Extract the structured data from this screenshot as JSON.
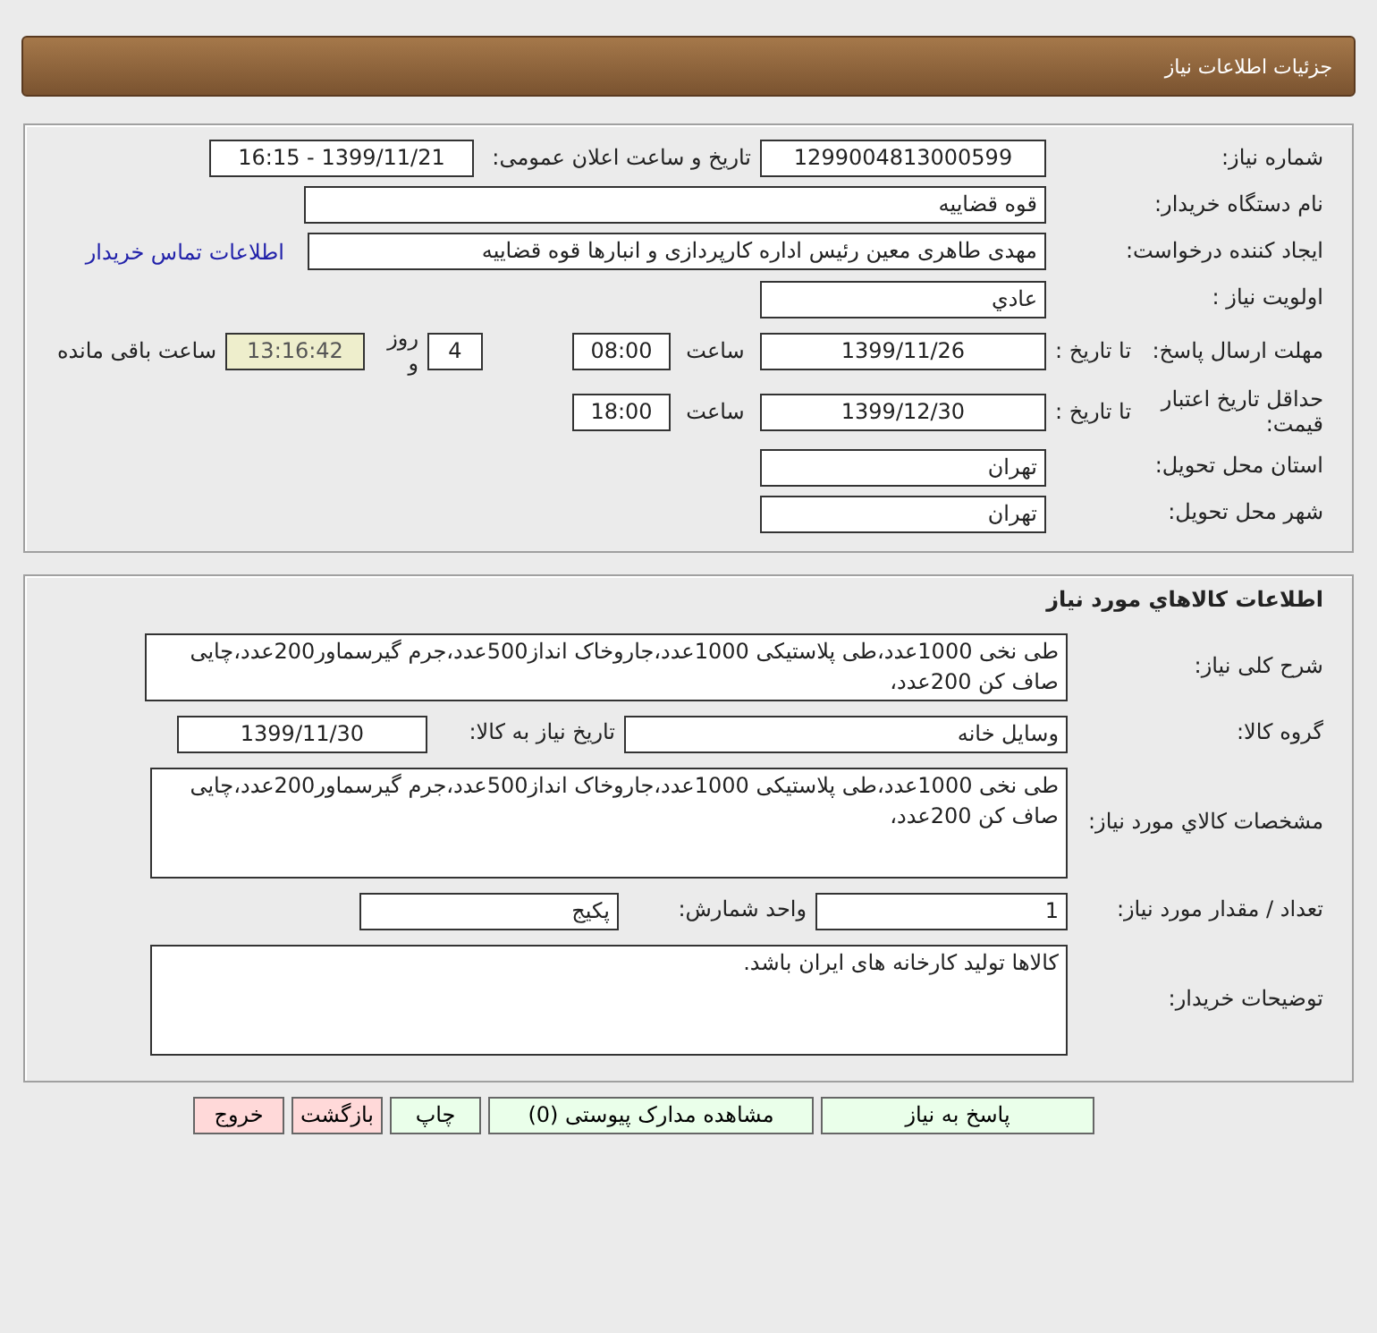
{
  "header": {
    "title": "جزئیات اطلاعات نیاز"
  },
  "need": {
    "number_label": "شماره نیاز:",
    "number": "1299004813000599",
    "announce_label": "تاریخ و ساعت اعلان عمومی:",
    "announce": "1399/11/21 - 16:15",
    "buyer_label": "نام دستگاه خریدار:",
    "buyer": "قوه قضاییه",
    "creator_label": "ایجاد کننده درخواست:",
    "creator": "مهدی طاهری معین رئیس اداره کارپردازی و انبارها قوه قضاییه",
    "contact_link": "اطلاعات تماس خریدار",
    "priority_label": "اولویت نیاز :",
    "priority": "عادي",
    "deadline_label": "مهلت ارسال پاسخ:",
    "deadline_to": "تا تاریخ :",
    "deadline_date": "1399/11/26",
    "deadline_time_label": "ساعت",
    "deadline_time": "08:00",
    "days": "4",
    "days_label": "روز و",
    "remaining": "13:16:42",
    "remaining_label": "ساعت باقی مانده",
    "validity_label": "حداقل تاریخ اعتبار قیمت:",
    "validity_to": "تا تاریخ :",
    "validity_date": "1399/12/30",
    "validity_time_label": "ساعت",
    "validity_time": "18:00",
    "province_label": "استان محل تحویل:",
    "province": "تهران",
    "city_label": "شهر محل تحویل:",
    "city": "تهران"
  },
  "goods": {
    "title": "اطلاعات کالاهاي مورد نیاز",
    "summary_label": "شرح کلی نیاز:",
    "summary": "طی نخی 1000عدد،طی پلاستیکی 1000عدد،جاروخاک انداز500عدد،جرم گیرسماور200عدد،چایی صاف کن 200عدد،",
    "group_label": "گروه کالا:",
    "group": "وسایل خانه",
    "need_date_label": "تاریخ نیاز به کالا:",
    "need_date": "1399/11/30",
    "specs_label": "مشخصات کالاي مورد نیاز:",
    "specs": "طی نخی 1000عدد،طی پلاستیکی 1000عدد،جاروخاک انداز500عدد،جرم گیرسماور200عدد،چایی صاف کن 200عدد،",
    "qty_label": "تعداد / مقدار مورد نیاز:",
    "qty": "1",
    "unit_label": "واحد شمارش:",
    "unit": "پکیج",
    "notes_label": "توضیحات خریدار:",
    "notes": "کالاها تولید کارخانه های ایران باشد."
  },
  "buttons": [
    {
      "label": "پاسخ به نیاز",
      "kind": "normal"
    },
    {
      "label": "مشاهده مدارک پیوستی (0)",
      "kind": "normal"
    },
    {
      "label": "چاپ",
      "kind": "normal"
    },
    {
      "label": "بازگشت",
      "kind": "exit"
    },
    {
      "label": "خروج",
      "kind": "exit"
    }
  ]
}
